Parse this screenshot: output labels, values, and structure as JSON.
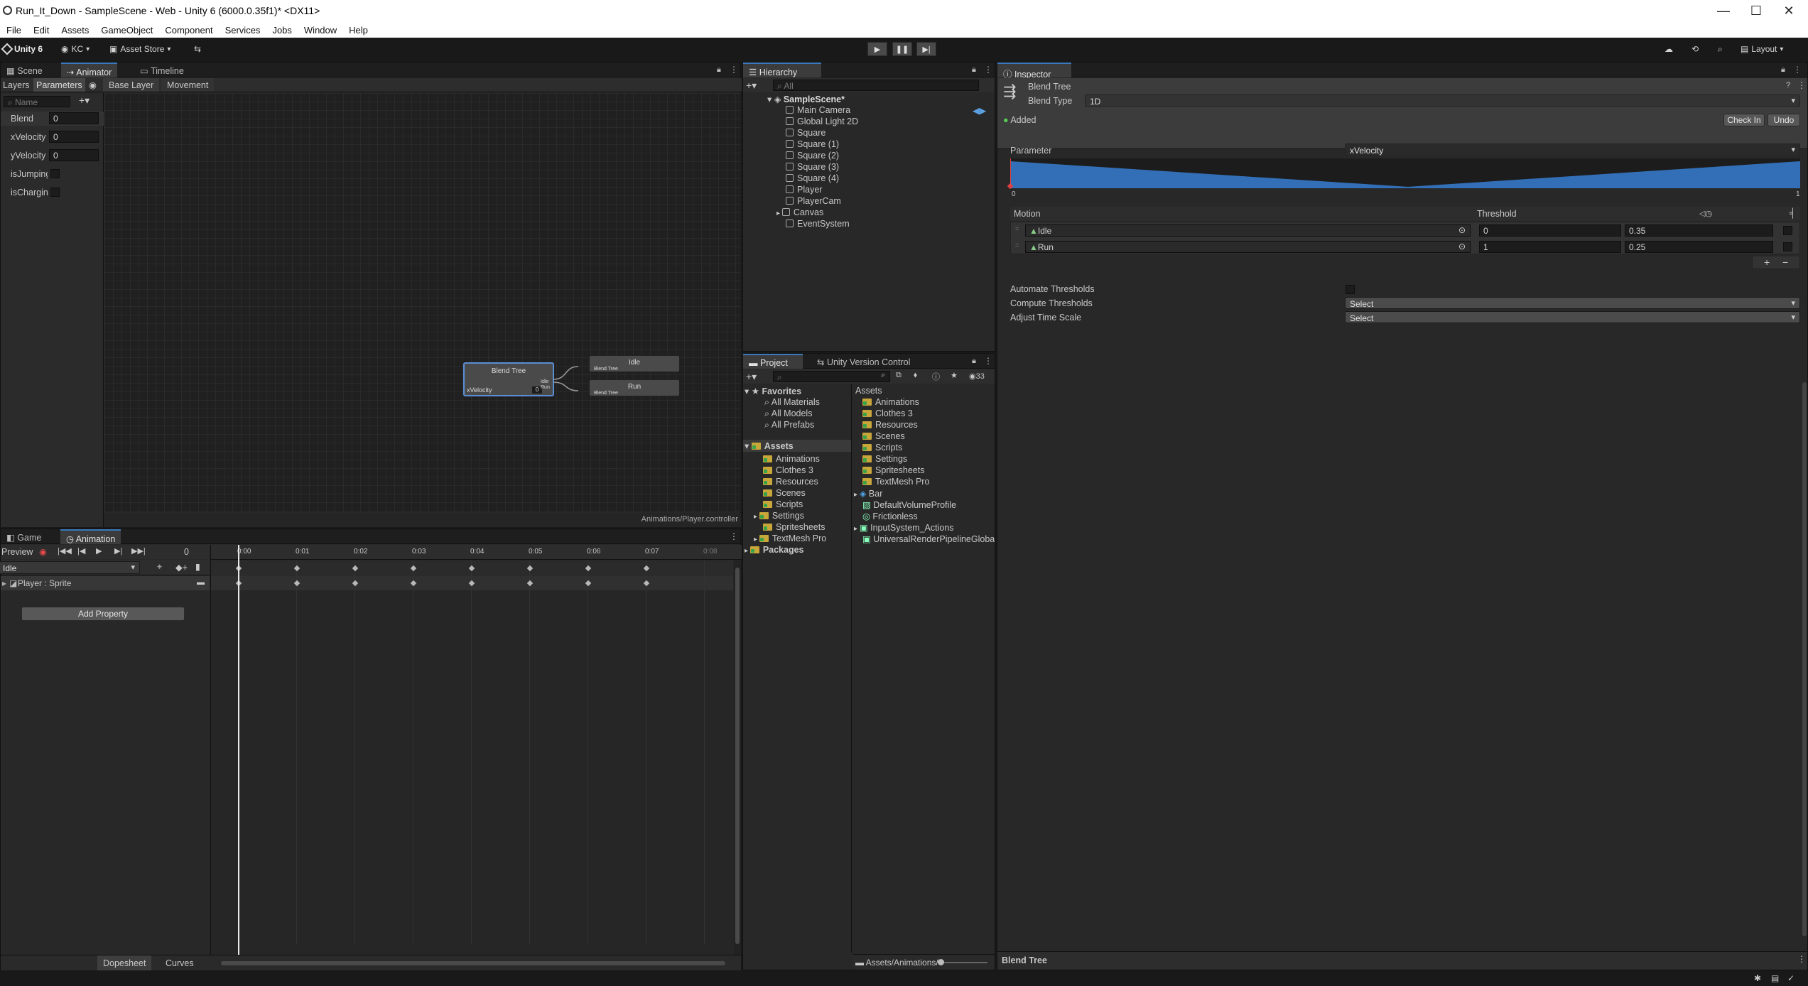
{
  "window": {
    "title": "Run_It_Down - SampleScene - Web - Unity 6 (6000.0.35f1)* <DX11>",
    "minimize": "—",
    "maximize": "☐",
    "close": "✕"
  },
  "menu": [
    "File",
    "Edit",
    "Assets",
    "GameObject",
    "Component",
    "Services",
    "Jobs",
    "Window",
    "Help"
  ],
  "toolbar": {
    "unity": "Unity 6",
    "account": "KC",
    "asset_store": "Asset Store",
    "layout": "Layout"
  },
  "animator": {
    "tabs": [
      "Scene",
      "Animator",
      "Timeline"
    ],
    "subtabs": [
      "Layers",
      "Parameters"
    ],
    "breadcrumb": [
      "Base Layer",
      "Movement"
    ],
    "search_placeholder": "Name",
    "params": [
      {
        "name": "Blend",
        "value": "0"
      },
      {
        "name": "xVelocity",
        "value": "0"
      },
      {
        "name": "yVelocity",
        "value": "0"
      },
      {
        "name": "isJumping",
        "value": ""
      },
      {
        "name": "isCharging",
        "value": ""
      }
    ],
    "blend_node": {
      "title": "Blend Tree",
      "param": "xVelocity",
      "value": "0",
      "outs": "Idle Run"
    },
    "idle_node": {
      "title": "Idle",
      "sub": "Blend Tree"
    },
    "run_node": {
      "title": "Run",
      "sub": "Blend Tree"
    },
    "path": "Animations/Player.controller"
  },
  "animation": {
    "tabs": [
      "Game",
      "Animation"
    ],
    "preview": "Preview",
    "frame": "0",
    "clip": "Idle",
    "ticks": [
      "0:00",
      "0:01",
      "0:02",
      "0:03",
      "0:04",
      "0:05",
      "0:06",
      "0:07",
      "0:08"
    ],
    "property": "Player : Sprite",
    "add_property": "Add Property",
    "bottom_tabs": [
      "Dopesheet",
      "Curves"
    ]
  },
  "hierarchy": {
    "tab": "Hierarchy",
    "search_placeholder": "All",
    "scene": "SampleScene*",
    "items": [
      "Main Camera",
      "Global Light 2D",
      "Square",
      "Square (1)",
      "Square (2)",
      "Square (3)",
      "Square (4)",
      "Player",
      "PlayerCam",
      "Canvas",
      "EventSystem"
    ]
  },
  "project": {
    "tabs": [
      "Project",
      "Unity Version Control"
    ],
    "count": "33",
    "favorites": "Favorites",
    "fav_items": [
      "All Materials",
      "All Models",
      "All Prefabs"
    ],
    "assets": "Assets",
    "tree": [
      "Animations",
      "Clothes 3",
      "Resources",
      "Scenes",
      "Scripts",
      "Settings",
      "Spritesheets",
      "TextMesh Pro"
    ],
    "packages": "Packages",
    "assets_header": "Assets",
    "list": [
      "Animations",
      "Clothes 3",
      "Resources",
      "Scenes",
      "Scripts",
      "Settings",
      "Spritesheets",
      "TextMesh Pro",
      "Bar",
      "DefaultVolumeProfile",
      "Frictionless",
      "InputSystem_Actions",
      "UniversalRenderPipelineGloba"
    ],
    "path": "Assets/Animations/"
  },
  "inspector": {
    "tab": "Inspector",
    "name": "Blend Tree",
    "blend_type_label": "Blend Type",
    "blend_type": "1D",
    "added": "Added",
    "check_in": "Check In",
    "undo": "Undo",
    "parameter_label": "Parameter",
    "parameter": "xVelocity",
    "range_min": "0",
    "range_max": "1",
    "motion_header": "Motion",
    "threshold_header": "Threshold",
    "motions": [
      {
        "name": "Idle",
        "threshold": "0",
        "speed": "0.35"
      },
      {
        "name": "Run",
        "threshold": "1",
        "speed": "0.25"
      }
    ],
    "automate": "Automate Thresholds",
    "compute": "Compute Thresholds",
    "compute_value": "Select",
    "adjust": "Adjust Time Scale",
    "adjust_value": "Select",
    "footer": "Blend Tree"
  },
  "colors": {
    "accent": "#3a79bb",
    "selected_node": "#5a8fd6",
    "graph_fill": "#2f6cb5"
  }
}
